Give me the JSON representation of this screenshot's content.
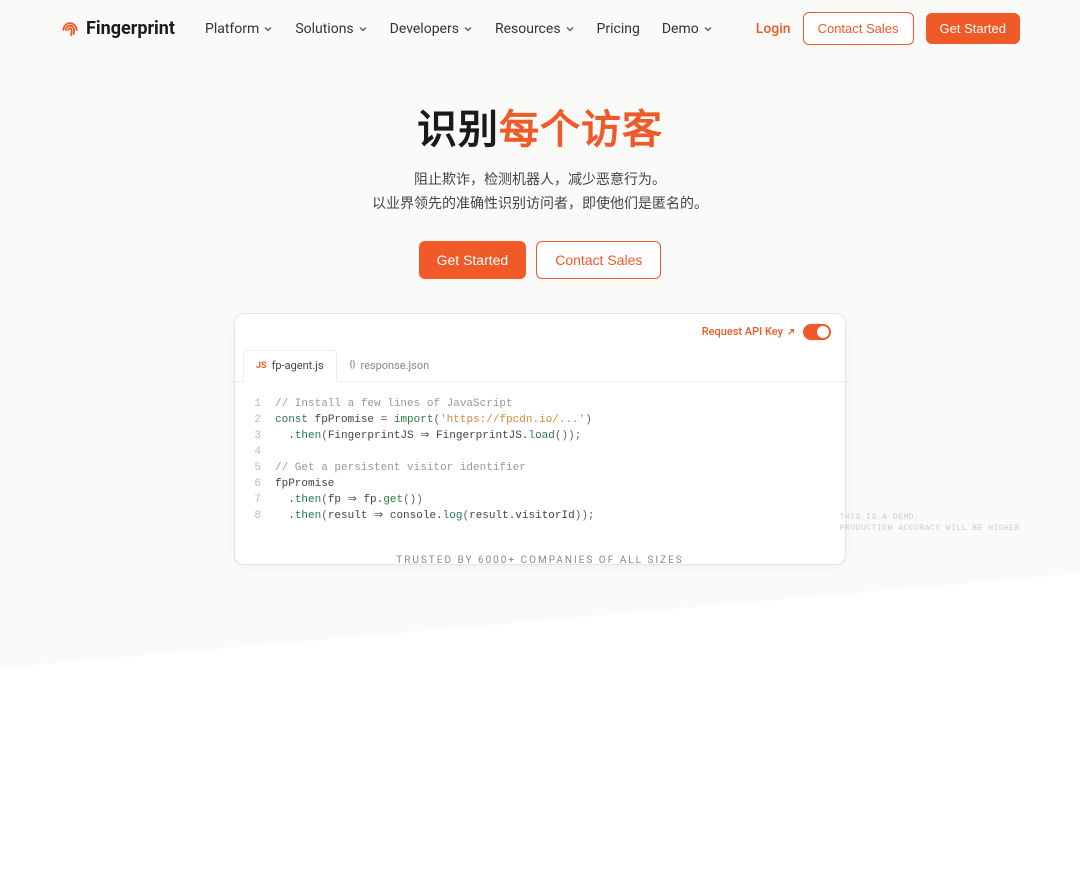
{
  "brand": "Fingerprint",
  "nav": {
    "platform": "Platform",
    "solutions": "Solutions",
    "developers": "Developers",
    "resources": "Resources",
    "pricing": "Pricing",
    "demo": "Demo"
  },
  "header_actions": {
    "login": "Login",
    "contact_sales": "Contact Sales",
    "get_started": "Get Started"
  },
  "hero": {
    "title_plain": "识别",
    "title_accent": "每个访客",
    "sub_line1": "阻止欺诈，检测机器人，减少恶意行为。",
    "sub_line2": "以业界领先的准确性识别访问者，即使他们是匿名的。",
    "cta_primary": "Get Started",
    "cta_secondary": "Contact Sales"
  },
  "code_card": {
    "request_api": "Request API Key",
    "tabs": {
      "js_badge": "JS",
      "js_label": "fp-agent.js",
      "json_badge": "{}",
      "json_label": "response.json"
    },
    "lines": [
      {
        "n": "1",
        "parts": [
          {
            "cls": "c-comment",
            "t": "// Install a few lines of JavaScript"
          }
        ]
      },
      {
        "n": "2",
        "parts": [
          {
            "cls": "c-key",
            "t": "const"
          },
          {
            "cls": "c-var",
            "t": " fpPromise = "
          },
          {
            "cls": "c-key",
            "t": "import"
          },
          {
            "cls": "c-paren",
            "t": "("
          },
          {
            "cls": "c-str",
            "t": "'https://fpcdn.io/...'"
          },
          {
            "cls": "c-paren",
            "t": ")"
          }
        ]
      },
      {
        "n": "3",
        "parts": [
          {
            "cls": "c-var",
            "t": "  ."
          },
          {
            "cls": "c-method",
            "t": "then"
          },
          {
            "cls": "c-paren",
            "t": "("
          },
          {
            "cls": "c-var",
            "t": "FingerprintJS ⇒ FingerprintJS."
          },
          {
            "cls": "c-method",
            "t": "load"
          },
          {
            "cls": "c-paren",
            "t": "());"
          }
        ]
      },
      {
        "n": "4",
        "parts": [
          {
            "cls": "c-var",
            "t": ""
          }
        ]
      },
      {
        "n": "5",
        "parts": [
          {
            "cls": "c-comment",
            "t": "// Get a persistent visitor identifier"
          }
        ]
      },
      {
        "n": "6",
        "parts": [
          {
            "cls": "c-var",
            "t": "fpPromise"
          }
        ]
      },
      {
        "n": "7",
        "parts": [
          {
            "cls": "c-var",
            "t": "  ."
          },
          {
            "cls": "c-method",
            "t": "then"
          },
          {
            "cls": "c-paren",
            "t": "("
          },
          {
            "cls": "c-var",
            "t": "fp ⇒ fp."
          },
          {
            "cls": "c-method",
            "t": "get"
          },
          {
            "cls": "c-paren",
            "t": "())"
          }
        ]
      },
      {
        "n": "8",
        "parts": [
          {
            "cls": "c-var",
            "t": "  ."
          },
          {
            "cls": "c-method",
            "t": "then"
          },
          {
            "cls": "c-paren",
            "t": "("
          },
          {
            "cls": "c-var",
            "t": "result ⇒ console."
          },
          {
            "cls": "c-method",
            "t": "log"
          },
          {
            "cls": "c-paren",
            "t": "("
          },
          {
            "cls": "c-var",
            "t": "result.visitorId"
          },
          {
            "cls": "c-paren",
            "t": "));"
          }
        ]
      }
    ]
  },
  "demo_note": {
    "line1": "THIS IS A DEMO.",
    "line2": "PRODUCTION ACCURACY WILL BE HIGHER"
  },
  "trusted": "TRUSTED BY 6000+ COMPANIES OF ALL SIZES"
}
